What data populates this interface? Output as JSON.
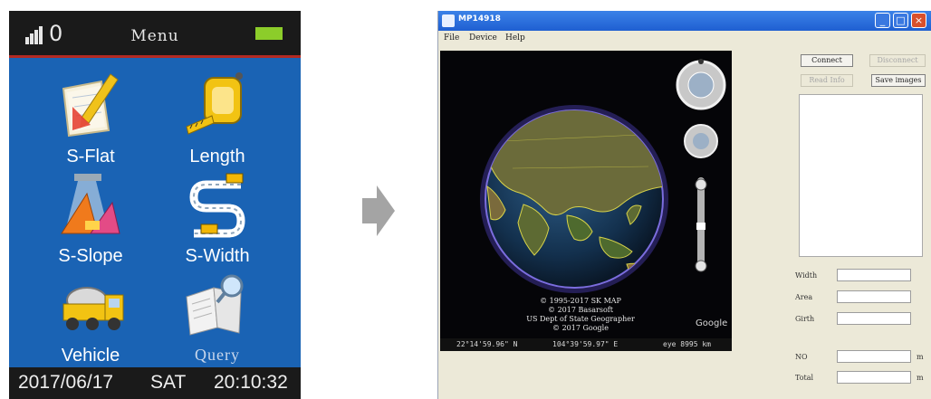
{
  "device": {
    "title": "Menu",
    "signal_count": "0",
    "menu_items": [
      {
        "label": "S-Flat",
        "icon": "s-flat-icon"
      },
      {
        "label": "Length",
        "icon": "tape-measure-icon"
      },
      {
        "label": "S-Slope",
        "icon": "s-slope-icon"
      },
      {
        "label": "S-Width",
        "icon": "s-width-icon"
      },
      {
        "label": "Vehicle",
        "icon": "vehicle-icon"
      },
      {
        "label": "Query",
        "icon": "query-icon"
      }
    ],
    "status": {
      "date": "2017/06/17",
      "day": "SAT",
      "time": "20:10:32"
    },
    "colors": {
      "background": "#1a63b4",
      "header": "#1a1a1a",
      "battery": "#8ccd2a",
      "header_border": "#b32a22"
    }
  },
  "window": {
    "title": "MP14918",
    "menu": [
      "File",
      "Device",
      "Help"
    ],
    "buttons": {
      "connect": "Connect",
      "disconnect": "Disconnect",
      "read_info": "Read Info",
      "save_images": "Save images"
    },
    "map": {
      "attribution": [
        "© 1995-2017 SK MAP",
        "© 2017 Basarsoft",
        "US Dept of State Geographer",
        "© 2017 Google"
      ],
      "brand": "Google",
      "status": {
        "lat": "22°14'59.96\" N",
        "lon": "104°39'59.97\" E",
        "eye": "eye 8995 km"
      }
    },
    "fields": [
      {
        "label": "Width",
        "value": "",
        "unit": ""
      },
      {
        "label": "Area",
        "value": "",
        "unit": ""
      },
      {
        "label": "Girth",
        "value": "",
        "unit": ""
      },
      {
        "label": "NO",
        "value": "",
        "unit": "m"
      },
      {
        "label": "Total",
        "value": "",
        "unit": "m"
      }
    ]
  }
}
